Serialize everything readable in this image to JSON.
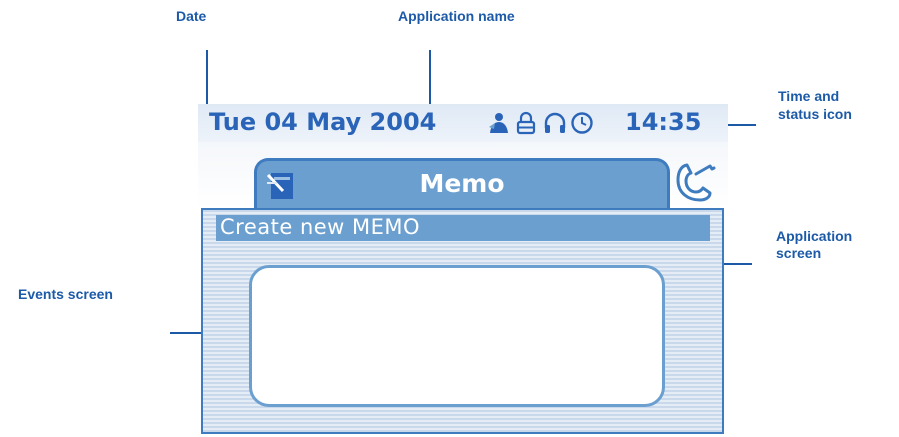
{
  "callouts": {
    "date": "Date",
    "application_name": "Application name",
    "time_status_line1": "Time and",
    "time_status_line2": "status icon",
    "application_screen_line1": "Application",
    "application_screen_line2": "screen",
    "events_screen": "Events screen"
  },
  "phone_display": {
    "status_bar": {
      "date": "Tue 04 May 2004",
      "time": "14:35",
      "icons": [
        "person-icon",
        "lock-icon",
        "headset-icon",
        "alarm-clock-icon"
      ]
    },
    "active_tab": {
      "title": "Memo",
      "icon": "memo-pad-icon"
    },
    "next_tab_icon": "handset-icon",
    "application_screen": {
      "selected_item": "Create new MEMO"
    }
  },
  "colors": {
    "callout_text": "#1c5aa8",
    "status_text": "#2a64b8",
    "tab_fill": "#6b9fd0",
    "frame": "#3f7cbf"
  }
}
